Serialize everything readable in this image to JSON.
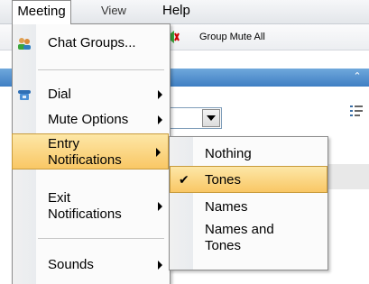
{
  "menubar": {
    "items": [
      {
        "label": "Meeting"
      },
      {
        "label": "View"
      },
      {
        "label": "Help"
      }
    ]
  },
  "toolbar": {
    "group_mute_label": "Group Mute All"
  },
  "meeting_menu": {
    "items": [
      {
        "label": "Chat Groups...",
        "icon": "chat-groups-icon"
      },
      {
        "label": "Dial",
        "icon": "phone-icon",
        "submenu": true
      },
      {
        "label": "Mute Options",
        "submenu": true
      },
      {
        "label": "Entry Notifications",
        "submenu": true,
        "active": true
      },
      {
        "label": "Exit Notifications",
        "submenu": true
      },
      {
        "label": "Sounds",
        "submenu": true
      }
    ]
  },
  "entry_notifications_submenu": {
    "options": [
      {
        "label": "Nothing",
        "checked": false
      },
      {
        "label": "Tones",
        "checked": true
      },
      {
        "label": "Names",
        "checked": false
      },
      {
        "label": "Names and Tones",
        "checked": false
      }
    ]
  },
  "colors": {
    "highlight": "#f9c765",
    "panel_header": "#3f7fc3"
  }
}
